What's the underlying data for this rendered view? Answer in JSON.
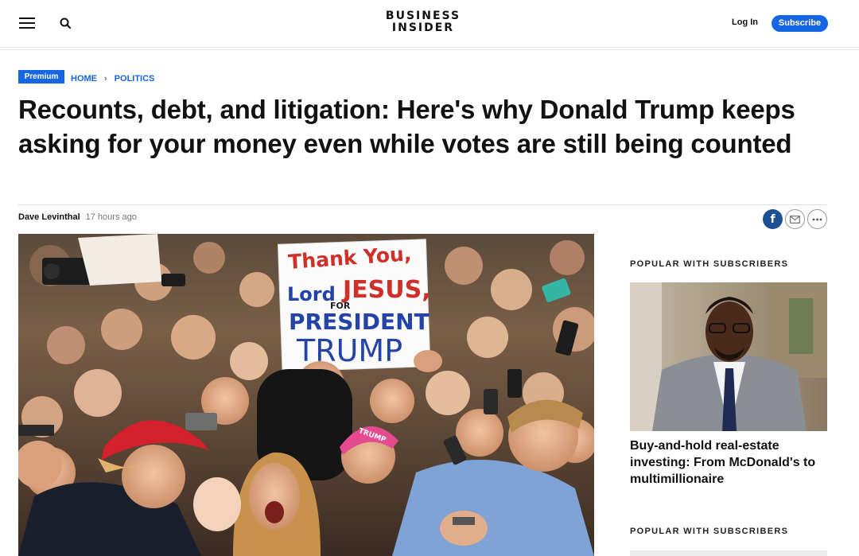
{
  "header": {
    "logo_line1": "BUSINESS",
    "logo_line2": "INSIDER",
    "login_label": "Log In",
    "subscribe_label": "Subscribe",
    "icons": [
      "menu-icon",
      "search-icon"
    ]
  },
  "article": {
    "badge": "Premium",
    "breadcrumb": [
      {
        "label": "HOME"
      },
      {
        "label": "POLITICS"
      }
    ],
    "breadcrumb_separator": "›",
    "headline": "Recounts, debt, and litigation: Here's why Donald Trump keeps asking for your money even while votes are still being counted",
    "author": "Dave Levinthal",
    "timestamp": "17 hours ago",
    "share": {
      "facebook_glyph": "f",
      "icons": [
        "facebook-icon",
        "mail-icon",
        "more-icon"
      ]
    },
    "hero_sign": {
      "line1": "Thank You,",
      "line2": "Lord",
      "line3": "JESUS,",
      "line4": "FOR",
      "line5": "PRESIDENT",
      "line6": "TRUMP"
    },
    "hat_text": "TRUMP"
  },
  "sidebar": {
    "section_title_1": "POPULAR WITH SUBSCRIBERS",
    "section_title_2": "POPULAR WITH SUBSCRIBERS",
    "story_1_headline": "Buy-and-hold real-estate investing: From McDonald's to multimillionaire"
  },
  "colors": {
    "brand_blue": "#1565e4",
    "facebook_blue": "#1d4f93",
    "text": "#111111",
    "muted": "#777777"
  }
}
